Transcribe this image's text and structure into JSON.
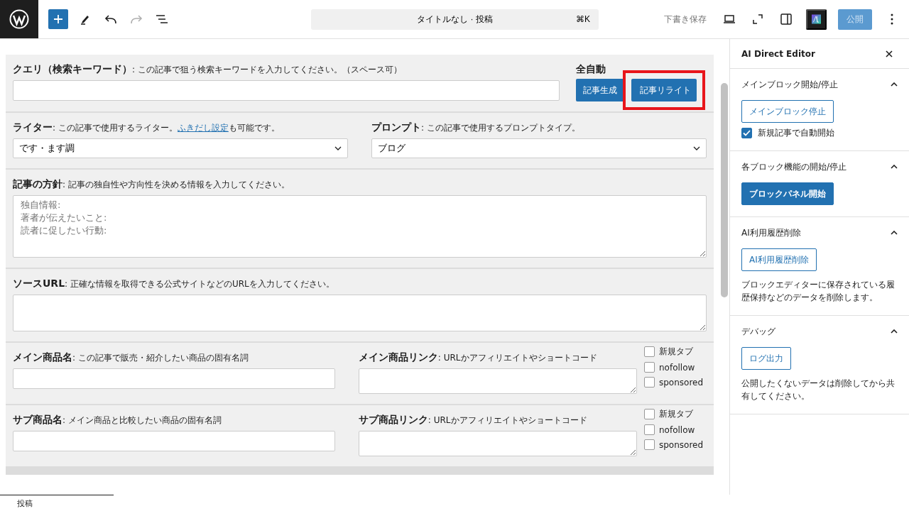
{
  "topbar": {
    "redo_disabled": true,
    "command_bar": {
      "title": "タイトルなし · 投稿",
      "shortcut": "⌘K"
    },
    "save_draft": "下書き保存",
    "publish": {
      "label": "公開",
      "disabled": true
    }
  },
  "form": {
    "rows": [
      {
        "fields": [
          {
            "kind": "input",
            "title": "クエリ（検索キーワード）",
            "hint": [
              {
                "kind": "text",
                "text": " : この記事で狙う検索キーワードを入力してください。（スペース可）"
              }
            ]
          }
        ],
        "actions": {
          "title": "全自動",
          "buttons": [
            {
              "label": "記事生成",
              "highlighted": false
            },
            {
              "label": "記事リライト",
              "highlighted": true
            }
          ]
        }
      },
      {
        "fields": [
          {
            "kind": "select",
            "title": "ライター",
            "hint": [
              {
                "kind": "text",
                "text": " : この記事で使用するライター。"
              },
              {
                "kind": "link",
                "text": "ふきだし設定"
              },
              {
                "kind": "text",
                "text": "も可能です。"
              }
            ],
            "value": "です・ます調"
          },
          {
            "kind": "select",
            "title": "プロンプト",
            "hint": [
              {
                "kind": "text",
                "text": " : この記事で使用するプロンプトタイプ。"
              }
            ],
            "value": "ブログ"
          }
        ]
      },
      {
        "fields": [
          {
            "kind": "textarea",
            "title": "記事の方針",
            "hint": [
              {
                "kind": "text",
                "text": " : 記事の独自性や方向性を決める情報を入力してください。"
              }
            ],
            "placeholder": "独自情報:\n著者が伝えたいこと:\n読者に促したい行動:"
          }
        ]
      },
      {
        "fields": [
          {
            "kind": "textarea",
            "title": "ソースURL",
            "hint": [
              {
                "kind": "text",
                "text": " : 正確な情報を取得できる公式サイトなどのURLを入力してください。"
              }
            ]
          }
        ]
      },
      {
        "fields": [
          {
            "kind": "input",
            "title": "メイン商品名",
            "hint": [
              {
                "kind": "text",
                "text": " : この記事で販売・紹介したい商品の固有名詞"
              }
            ]
          },
          {
            "kind": "link-area",
            "title": "メイン商品リンク",
            "hint": [
              {
                "kind": "text",
                "text": " : URLかアフィリエイトやショートコード"
              }
            ],
            "options": [
              {
                "label": "新規タブ",
                "checked": false
              },
              {
                "label": "nofollow",
                "checked": false
              },
              {
                "label": "sponsored",
                "checked": false
              }
            ]
          }
        ]
      },
      {
        "fields": [
          {
            "kind": "input",
            "title": "サブ商品名",
            "hint": [
              {
                "kind": "text",
                "text": " : メイン商品と比較したい商品の固有名詞"
              }
            ]
          },
          {
            "kind": "link-area",
            "title": "サブ商品リンク",
            "hint": [
              {
                "kind": "text",
                "text": " : URLかアフィリエイトやショートコード"
              }
            ],
            "options": [
              {
                "label": "新規タブ",
                "checked": false
              },
              {
                "label": "nofollow",
                "checked": false
              },
              {
                "label": "sponsored",
                "checked": false
              }
            ]
          }
        ]
      }
    ]
  },
  "sidebar": {
    "title": "AI Direct Editor",
    "sections": [
      {
        "title": "メインブロック開始/停止",
        "expanded": true,
        "items": [
          {
            "kind": "button",
            "label": "メインブロック停止"
          },
          {
            "kind": "checkbox",
            "label": "新規記事で自動開始",
            "checked": true
          }
        ]
      },
      {
        "title": "各ブロック機能の開始/停止",
        "expanded": true,
        "items": [
          {
            "kind": "button",
            "label": "ブロックパネル開始"
          }
        ]
      },
      {
        "title": "AI利用履歴削除",
        "expanded": true,
        "items": [
          {
            "kind": "button",
            "label": "AI利用履歴削除"
          },
          {
            "kind": "text",
            "text": "ブロックエディターに保存されている履歴保持などのデータを削除します。"
          }
        ]
      },
      {
        "title": "デバッグ",
        "expanded": true,
        "items": [
          {
            "kind": "button",
            "label": "ログ出力"
          },
          {
            "kind": "text",
            "text": "公開したくないデータは削除してから共有してください。"
          }
        ]
      }
    ]
  },
  "footer": {
    "breadcrumb": "投稿"
  }
}
